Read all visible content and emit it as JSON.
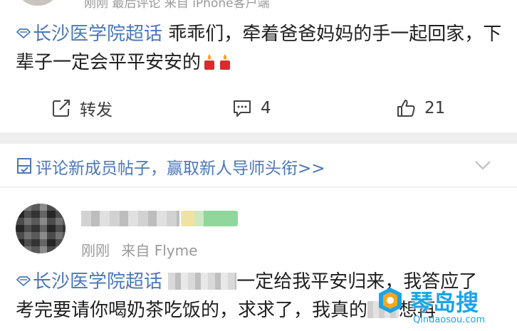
{
  "post1": {
    "meta_partial": "刚刚 最后评论 来自 iPhone客户端",
    "topic": "长沙医学院超话",
    "text": "乖乖们，牵着爸爸妈妈的手一起回家，下辈子一定会平平安安的",
    "emoji": "candle-icon"
  },
  "actions": {
    "repost_label": "转发",
    "comment_count": "4",
    "like_count": "21"
  },
  "banner": {
    "text": "评论新成员帖子，赢取新人导师头衔>>"
  },
  "post2": {
    "time": "刚刚",
    "source": "来自 Flyme",
    "topic": "长沙医学院超话",
    "text_a": "一定给我平安归来，我答应了",
    "text_b": "考完要请你喝奶茶吃饭的，求求了，我真的",
    "text_c": "想再"
  },
  "watermark": {
    "text": "琴岛搜",
    "url": "Qindaosou.com"
  },
  "colors": {
    "link": "#4b77b8",
    "separator": "#eeeeee",
    "watermark": "#1aa5e8"
  }
}
